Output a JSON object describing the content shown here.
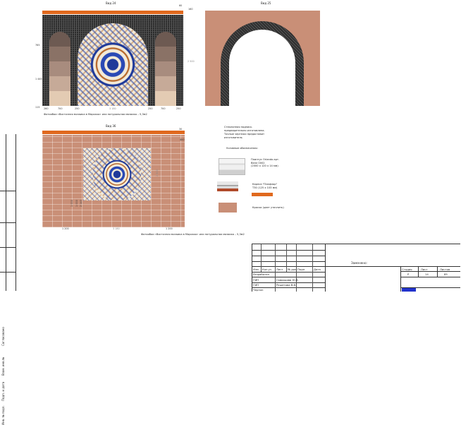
{
  "views": {
    "view24": {
      "title": "Вид 24"
    },
    "view25": {
      "title": "Вид 25"
    },
    "view36": {
      "title": "Вид 36"
    }
  },
  "dims24": {
    "top_right": "60",
    "top_right2": "160",
    "side_a": "765",
    "side_b": "1 445",
    "side_c": "115",
    "right_h": "2 500",
    "bottom": [
      "260",
      "700",
      "250",
      "3 180",
      "250",
      "700",
      "250"
    ]
  },
  "dims36": {
    "top": "30",
    "right": "400",
    "left1": "1 000",
    "left2": "1 000",
    "left3": "2 140",
    "center_v": "2 500",
    "bottom": [
      "1 200",
      "3 180",
      "1 200"
    ]
  },
  "captions": {
    "cap24": "Фотообои «Восточная мозаика в Марокко» или натуральная мозаика – 5,3м2",
    "cap36": "Фотообои «Восточная мозаика в Марокко» или натуральная мозаика – 5,3м2",
    "note": "Стеклянная надпись\nпредварительно изготовлена.\nТочные чертежи предоставит\nизготовитель"
  },
  "legend": {
    "title": "Условные обозначения:",
    "items": [
      {
        "text": "Плинтус Orlando арт.\nВелл 0002\n(2000 x 120 x 14 мм)"
      },
      {
        "text": "Карниз \"Плафлор\"\nT30 (125 x 103 мм)"
      },
      {
        "text": "Краска (цвет уточнить)"
      }
    ]
  },
  "leftbar": {
    "labels": [
      "Согласовано",
      "Взам. инв.№",
      "Подп. и дата",
      "Инв. № подл."
    ]
  },
  "stamp": {
    "headers": [
      "Изм.",
      "Кол.уч",
      "Лист",
      "№ док",
      "Подп.",
      "Дата"
    ],
    "rows": [
      {
        "role": "Разработал",
        "name": ""
      },
      {
        "role": "ГИП",
        "name": "Скворцова Ю.В."
      },
      {
        "role": "ГИП",
        "name": "Решетова В.В."
      },
      {
        "role": "Чертил",
        "name": ""
      }
    ],
    "doc_title": "Заменено:",
    "stage_h": "Стадия",
    "sheet_h": "Лист",
    "sheets_h": "Листов",
    "stage": "Р",
    "sheet": "14",
    "sheets": "85"
  },
  "colors": {
    "orange": "#e0691e",
    "brick": "#c98f77",
    "blue_logo": "#2233cc"
  }
}
